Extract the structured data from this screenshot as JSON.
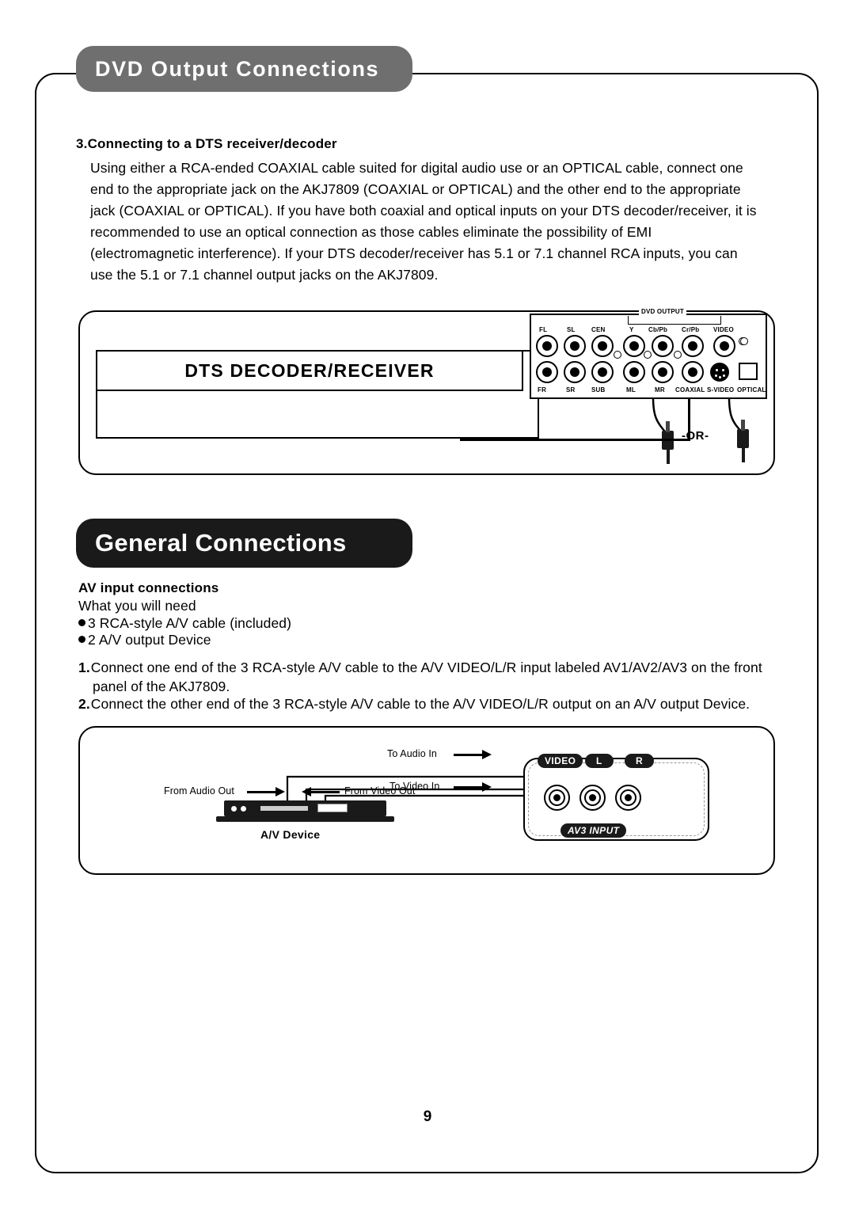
{
  "page": {
    "number": "9"
  },
  "sections": [
    {
      "id": "dvd",
      "title": "DVD Output Connections"
    },
    {
      "id": "general",
      "title": "General Connections"
    }
  ],
  "dts": {
    "heading_num": "3.",
    "heading": "Connecting to a DTS receiver/decoder",
    "paragraph": "Using either a RCA-ended COAXIAL cable suited for digital audio use or an OPTICAL cable, connect one end to the appropriate jack on the AKJ7809 (COAXIAL or OPTICAL) and the other end to the appropriate jack (COAXIAL or OPTICAL). If you have both coaxial and optical inputs on your DTS decoder/receiver, it is recommended to use an optical connection as those cables eliminate the possibility of EMI (electromagnetic interference). If your DTS decoder/receiver has 5.1 or 7.1 channel RCA inputs, you can use the 5.1 or 7.1 channel output jacks on the AKJ7809.",
    "figure": {
      "device_label": "DTS DECODER/RECEIVER",
      "panel_title": "DVD OUTPUT",
      "top_labels": [
        "FL",
        "SL",
        "CEN",
        "Y",
        "Cb/Pb",
        "Cr/Pb",
        "VIDEO"
      ],
      "bottom_labels": [
        "FR",
        "SR",
        "SUB",
        "ML",
        "MR",
        "COAXIAL",
        "S-VIDEO",
        "OPTICAL"
      ],
      "or_label": "-OR-"
    }
  },
  "general": {
    "heading": "AV input connections",
    "what_you_need_label": "What you will need",
    "bullets": [
      "3 RCA-style A/V cable (included)",
      "2 A/V output Device"
    ],
    "steps": [
      {
        "num": "1.",
        "text": "Connect one end of the 3 RCA-style A/V cable to the A/V VIDEO/L/R input labeled AV1/AV2/AV3 on the front",
        "cont": "panel of the AKJ7809."
      },
      {
        "num": "2.",
        "text": "Connect the other end of the 3 RCA-style A/V cable to the A/V VIDEO/L/R output on an A/V output Device."
      }
    ],
    "figure": {
      "captions": {
        "to_audio_in": "To Audio In",
        "to_video_in": "To Video In",
        "from_audio_out": "From Audio Out",
        "from_video_out": "From Video Out"
      },
      "device_label": "A/V Device",
      "jack_labels": [
        "VIDEO",
        "L",
        "R"
      ],
      "panel_tag": "AV3 INPUT"
    }
  },
  "colors": {
    "pill_grey": "#6f6f6f",
    "pill_dark": "#1a1a1a",
    "ink": "#000000",
    "paper": "#ffffff"
  }
}
